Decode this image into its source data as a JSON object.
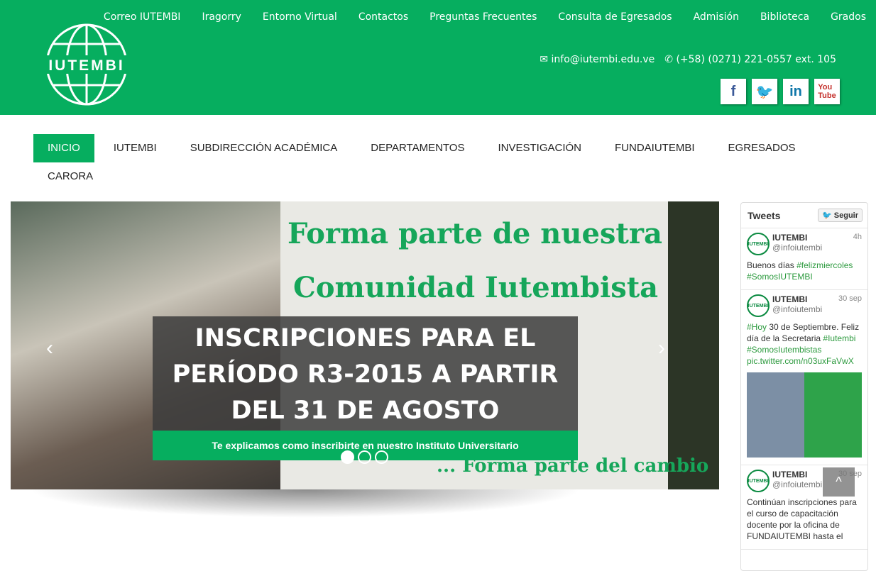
{
  "logo_text": "IUTEMBI",
  "top_nav": [
    "Correo IUTEMBI",
    "Iragorry",
    "Entorno Virtual",
    "Contactos",
    "Preguntas Frecuentes",
    "Consulta de Egresados",
    "Admisión",
    "Biblioteca",
    "Grados"
  ],
  "contact": {
    "email": "info@iutembi.edu.ve",
    "phone": "+58) (0271) 221-0557 ext. 105"
  },
  "social": [
    "facebook",
    "twitter",
    "linkedin",
    "youtube"
  ],
  "main_nav": [
    "INICIO",
    "IUTEMBI",
    "SUBDIRECCIÓN ACADÉMICA",
    "DEPARTAMENTOS",
    "INVESTIGACIÓN",
    "FUNDAIUTEMBI",
    "EGRESADOS",
    "CARORA"
  ],
  "slider": {
    "banner_line1": "Forma parte de nuestra",
    "banner_line2": "Comunidad Iutembista",
    "banner_footer": "... Forma parte del cambio",
    "caption": "INSCRIPCIONES PARA EL PERÍODO R3-2015 A PARTIR DEL 31 DE AGOSTO",
    "caption_sub": "Te explicamos como inscribirte en nuestro Instituto Universitario",
    "slides": 3,
    "active_slide": 1
  },
  "tweets": {
    "title": "Tweets",
    "follow": "Seguir",
    "items": [
      {
        "name": "IUTEMBI",
        "handle": "@infoiutembi",
        "time": "4h",
        "parts": [
          [
            "Buenos días ",
            0
          ],
          [
            "#felizmiercoles",
            1
          ],
          [
            " ",
            0
          ],
          [
            "#SomosIUTEMBI",
            1
          ]
        ]
      },
      {
        "name": "IUTEMBI",
        "handle": "@infoiutembi",
        "time": "30 sep",
        "parts": [
          [
            "#Hoy",
            1
          ],
          [
            " 30 de Septiembre. Feliz día de la Secretaria ",
            0
          ],
          [
            "#Iutembi",
            1
          ],
          [
            " ",
            0
          ],
          [
            "#SomosIutembistas",
            1
          ],
          [
            " pic.twitter.com/n03uxFaVwX",
            1
          ]
        ],
        "image": true
      },
      {
        "name": "IUTEMBI",
        "handle": "@infoiutembi",
        "time": "30 sep",
        "parts": [
          [
            "Continúan inscripciones para el curso de capacitación docente por la oficina de FUNDAIUTEMBI hasta el",
            0
          ]
        ]
      }
    ]
  },
  "back_to_top": "^"
}
